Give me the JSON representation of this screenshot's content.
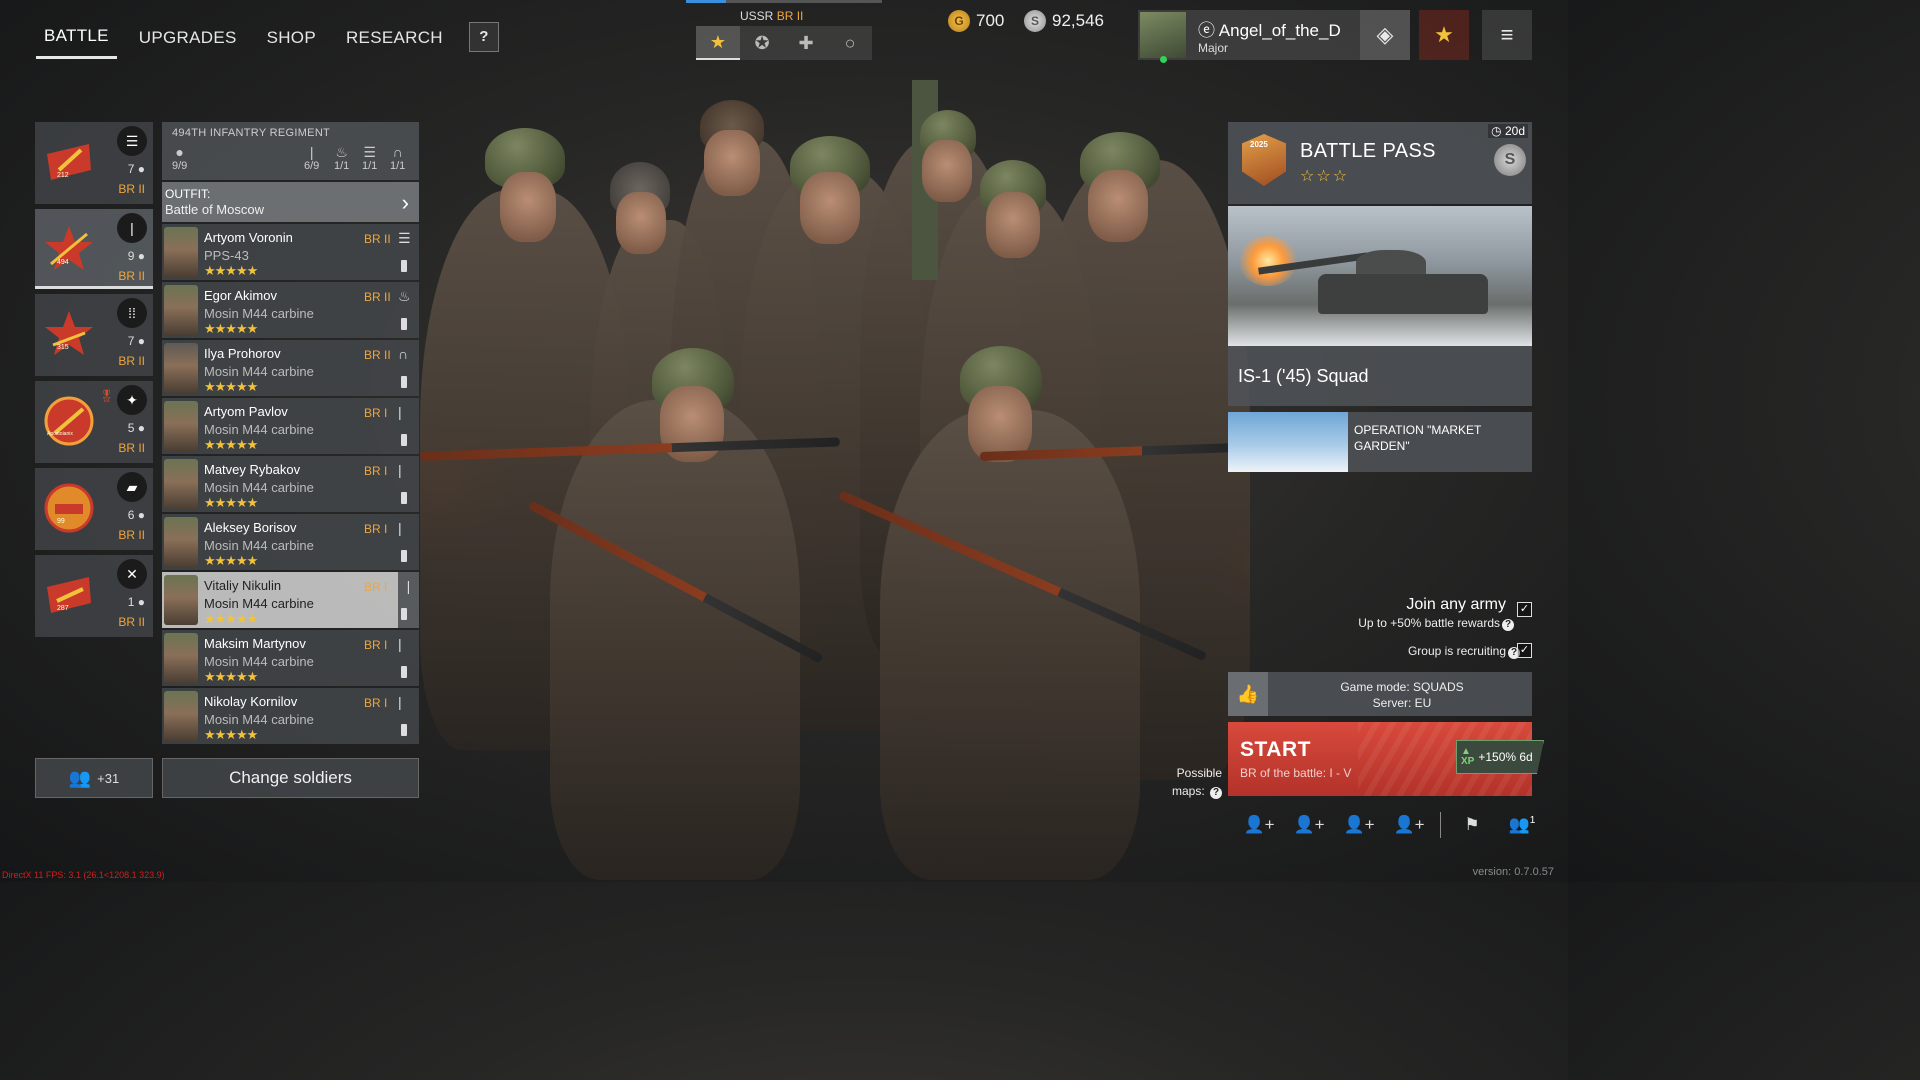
{
  "nav": {
    "tabs": [
      "BATTLE",
      "UPGRADES",
      "SHOP",
      "RESEARCH"
    ],
    "help_label": "?"
  },
  "nation": {
    "title": "USSR",
    "br": "BR II",
    "tab_icons": [
      "star-icon",
      "medal-icon",
      "cross-icon",
      "circle-icon"
    ]
  },
  "currency": {
    "gold": "700",
    "silver": "92,546"
  },
  "profile": {
    "name": "Angel_of_the_D",
    "rank": "Major"
  },
  "squads": [
    {
      "emblem_num": "212",
      "count": "7",
      "br": "BR II",
      "type_icon": "list-icon"
    },
    {
      "emblem_num": "494",
      "count": "9",
      "br": "BR II",
      "type_icon": "rifle-icon"
    },
    {
      "emblem_num": "315",
      "count": "7",
      "br": "BR II",
      "type_icon": "ammo-icon"
    },
    {
      "emblem_num": "Apostoianix",
      "count": "5",
      "br": "BR II",
      "type_icon": "gunner-icon"
    },
    {
      "emblem_num": "99",
      "count": "6",
      "br": "BR II",
      "type_icon": "tank-icon"
    },
    {
      "emblem_num": "287",
      "count": "1",
      "br": "BR II",
      "type_icon": "wrench-icon"
    }
  ],
  "regiment": {
    "name": "494TH INFANTRY REGIMENT",
    "stats": [
      "9/9",
      "6/9",
      "1/1",
      "1/1",
      "1/1"
    ]
  },
  "outfit": {
    "label": "OUTFIT:",
    "value": "Battle of Moscow"
  },
  "soldiers": [
    {
      "name": "Artyom Voronin",
      "weapon": "PPS-43",
      "br": "BR II",
      "role": "radio-icon",
      "stars": "★★★★★"
    },
    {
      "name": "Egor Akimov",
      "weapon": "Mosin M44 carbine",
      "br": "BR II",
      "role": "flame-icon",
      "stars": "★★★★★"
    },
    {
      "name": "Ilya Prohorov",
      "weapon": "Mosin M44 carbine",
      "br": "BR II",
      "role": "headset-icon",
      "stars": "★★★★★"
    },
    {
      "name": "Artyom Pavlov",
      "weapon": "Mosin M44 carbine",
      "br": "BR I",
      "role": "bullet-icon",
      "stars": "★★★★★"
    },
    {
      "name": "Matvey Rybakov",
      "weapon": "Mosin M44 carbine",
      "br": "BR I",
      "role": "bullet-icon",
      "stars": "★★★★★"
    },
    {
      "name": "Aleksey Borisov",
      "weapon": "Mosin M44 carbine",
      "br": "BR I",
      "role": "bullet-icon",
      "stars": "★★★★★"
    },
    {
      "name": "Vitaliy Nikulin",
      "weapon": "Mosin M44 carbine",
      "br": "BR I",
      "role": "bullet-icon",
      "stars": "★★★★★"
    },
    {
      "name": "Maksim Martynov",
      "weapon": "Mosin M44 carbine",
      "br": "BR I",
      "role": "bullet-icon",
      "stars": "★★★★★"
    },
    {
      "name": "Nikolay Kornilov",
      "weapon": "Mosin M44 carbine",
      "br": "BR I",
      "role": "bullet-icon",
      "stars": "★★★★★"
    }
  ],
  "reserve": {
    "label": "+31"
  },
  "change_soldiers": "Change soldiers",
  "battle_pass": {
    "title": "BATTLE PASS",
    "year": "2025",
    "stars": "☆☆☆",
    "timer": "20d"
  },
  "promo": {
    "title": "IS-1 ('45) Squad"
  },
  "event": {
    "title": "OPERATION \"MARKET GARDEN\""
  },
  "join": {
    "title": "Join any army",
    "subtitle": "Up to +50% battle rewards",
    "group": "Group is recruiting"
  },
  "mode": {
    "game_mode": "Game mode: SQUADS",
    "server": "Server: EU"
  },
  "start": {
    "label": "START",
    "br": "BR of the battle: I - V",
    "xp": "+150% 6d"
  },
  "maps": {
    "label_1": "Possible",
    "label_2": "maps:"
  },
  "bottom": {
    "friends_count": "1"
  },
  "version": "version: 0.7.0.57",
  "fps": "DirectX 11 FPS:  3.1 (26.1<1208.1 323.9)",
  "colors": {
    "accent_br": "#f0a53a",
    "start": "#c53b30",
    "stars": "#f2c23d"
  }
}
